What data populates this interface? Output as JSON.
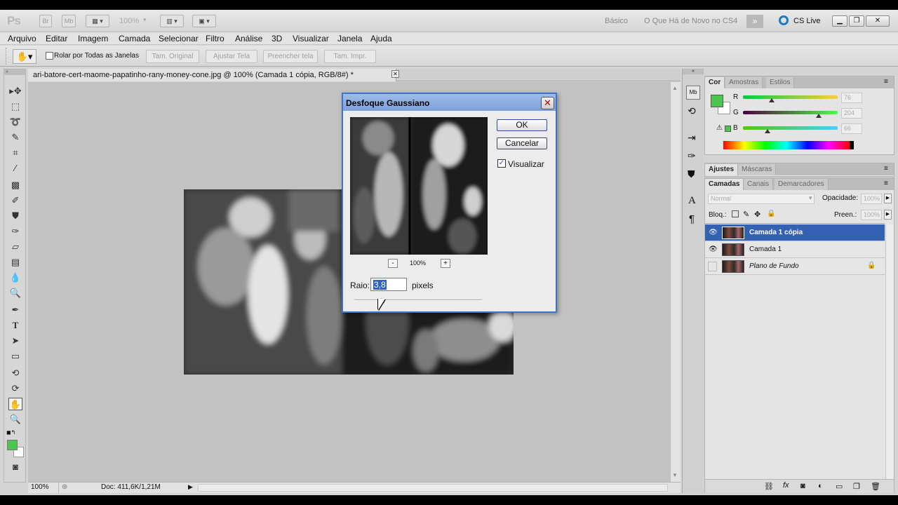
{
  "app": {
    "logo": "Ps",
    "zoom_display": "100%",
    "workspace_basic": "Básico",
    "workspace_new": "O Que Há de Novo no CS4",
    "cs_live": "CS Live"
  },
  "menu": [
    "Arquivo",
    "Editar",
    "Imagem",
    "Camada",
    "Selecionar",
    "Filtro",
    "Análise",
    "3D",
    "Visualizar",
    "Janela",
    "Ajuda"
  ],
  "options": {
    "scroll_all_label": "Rolar por Todas as Janelas",
    "buttons": [
      "Tam. Original",
      "Ajustar Tela",
      "Preencher tela",
      "Tam. Impr."
    ]
  },
  "document": {
    "tab_title": "ari-batore-cert-maome-papatinho-rany-money-cone.jpg @ 100% (Camada 1 cópia, RGB/8#) *",
    "status_zoom": "100%",
    "status_doc": "Doc: 411,6K/1,21M"
  },
  "dialog": {
    "title": "Desfoque Gaussiano",
    "ok": "OK",
    "cancel": "Cancelar",
    "preview_label": "Visualizar",
    "preview_checked": true,
    "zoom_minus": "-",
    "zoom_level": "100%",
    "zoom_plus": "+",
    "radius_label": "Raio:",
    "radius_value": "3,8",
    "radius_unit": "pixels"
  },
  "color_panel": {
    "tabs": [
      "Cor",
      "Amostras",
      "Estilos"
    ],
    "foreground_color": "#4cc64c",
    "channels": [
      {
        "label": "R",
        "value": "76",
        "level": 0.3
      },
      {
        "label": "G",
        "value": "204",
        "level": 0.8
      },
      {
        "label": "B",
        "value": "66",
        "level": 0.26
      }
    ]
  },
  "adjust_panel": {
    "tabs": [
      "Ajustes",
      "Máscaras"
    ]
  },
  "layers_panel": {
    "tabs": [
      "Camadas",
      "Canais",
      "Demarcadores"
    ],
    "blend_mode": "Normal",
    "opacity_label": "Opacidade:",
    "opacity_value": "100%",
    "lock_label": "Bloq.:",
    "fill_label": "Preen.:",
    "fill_value": "100%",
    "layers": [
      {
        "name": "Camada 1 cópia",
        "visible": true,
        "selected": true
      },
      {
        "name": "Camada 1",
        "visible": true,
        "selected": false
      },
      {
        "name": "Plano de Fundo",
        "visible": false,
        "selected": false,
        "locked": true
      }
    ]
  }
}
